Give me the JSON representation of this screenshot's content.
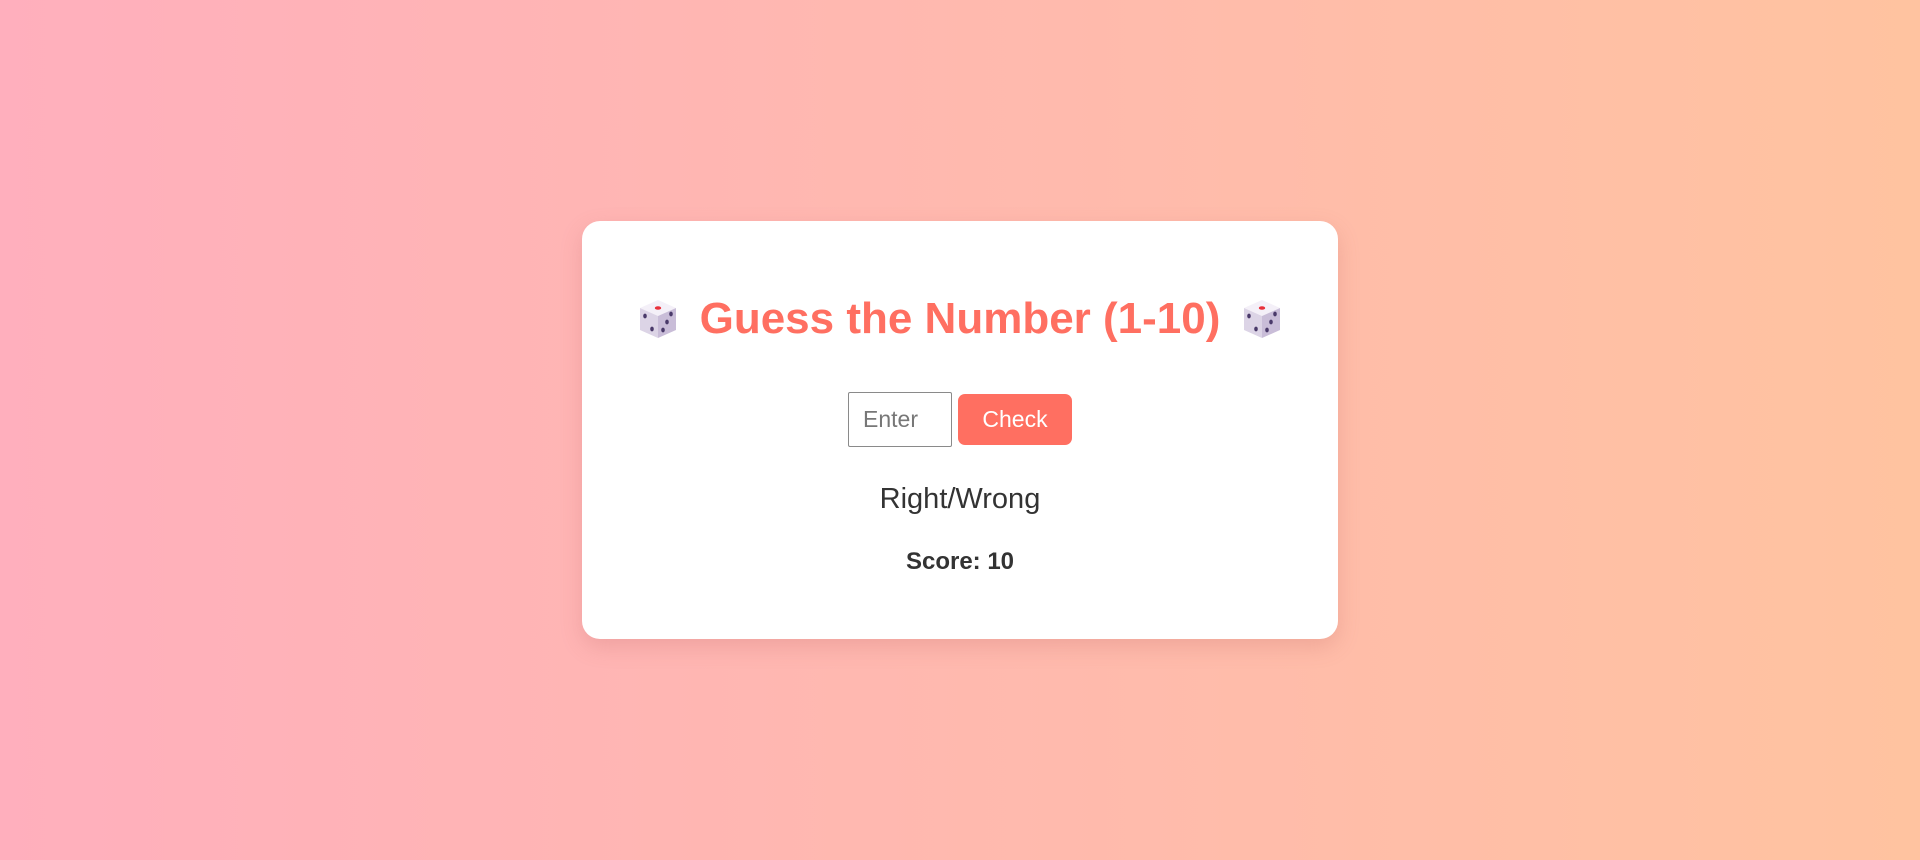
{
  "game": {
    "title": "Guess the Number (1-10)",
    "icon_left": "dice-icon",
    "icon_right": "dice-icon",
    "input_placeholder": "Enter",
    "input_value": "",
    "check_label": "Check",
    "result_text": "Right/Wrong",
    "score_text": "Score: 10"
  },
  "colors": {
    "accent": "#ff6f61",
    "background_start": "#ffafbd",
    "background_end": "#ffc3a0",
    "text": "#333333",
    "card": "#ffffff"
  }
}
